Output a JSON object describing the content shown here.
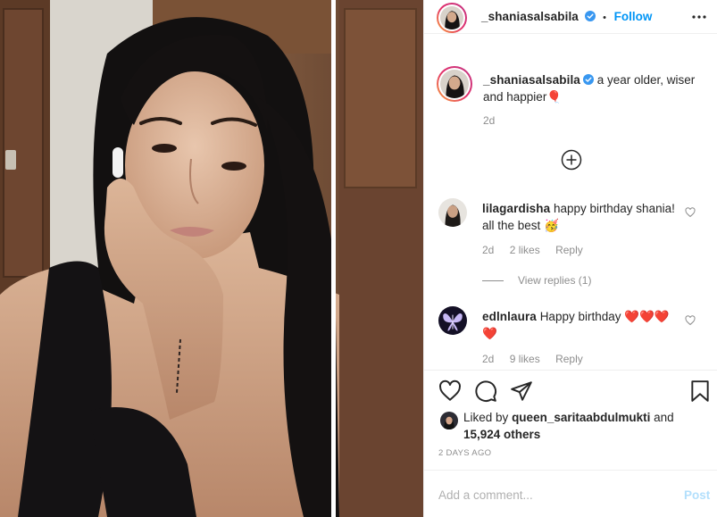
{
  "header": {
    "username": "_shaniasalsabila",
    "separator": "•",
    "follow_label": "Follow"
  },
  "caption": {
    "username": "_shaniasalsabila",
    "text": "a year older, wiser and happier🎈",
    "time": "2d"
  },
  "comments": [
    {
      "username": "lilagardisha",
      "text": "happy birthday shania! all the best 🥳",
      "time": "2d",
      "likes": "2 likes",
      "reply_label": "Reply",
      "view_replies": "View replies (1)"
    },
    {
      "username": "edlnlaura",
      "text": "Happy birthday ❤️❤️❤️❤️",
      "time": "2d",
      "likes": "9 likes",
      "reply_label": "Reply"
    }
  ],
  "likes": {
    "prefix": "Liked by",
    "user": "queen_saritaabdulmukti",
    "and": "and",
    "others": "15,924 others"
  },
  "post_date": "2 DAYS AGO",
  "composer": {
    "placeholder": "Add a comment...",
    "post_label": "Post"
  },
  "icons": {
    "verified": "verified-badge-icon",
    "more": "more-options-icon",
    "load_more": "load-more-comments-icon",
    "like": "heart-icon",
    "comment": "comment-icon",
    "share": "share-icon",
    "save": "bookmark-icon"
  },
  "colors": {
    "accent": "#0095f6",
    "muted": "#8e8e8e",
    "text": "#262626",
    "post_disabled": "#b2dffc"
  }
}
